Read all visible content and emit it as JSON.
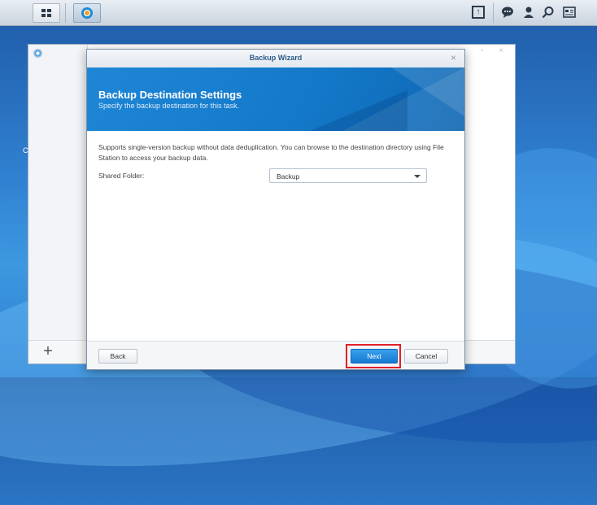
{
  "taskbar": {
    "main_menu_icon": "grid-icon",
    "active_app_icon": "backup-app-icon",
    "tray_icons": [
      "upload-icon",
      "chat-icon",
      "user-icon",
      "search-icon",
      "widgets-icon"
    ]
  },
  "background_window": {
    "add_label": "+",
    "edge_text": "C"
  },
  "wizard": {
    "window_title": "Backup Wizard",
    "close_label": "×",
    "header_title": "Backup Destination Settings",
    "header_subtitle": "Specify the backup destination for this task.",
    "description": "Supports single-version backup without data deduplication. You can browse to the destination directory using File Station to access your backup data.",
    "shared_folder_label": "Shared Folder:",
    "shared_folder_value": "Backup",
    "back_label": "Back",
    "next_label": "Next",
    "cancel_label": "Cancel"
  },
  "colors": {
    "accent": "#1479d3",
    "highlight": "#e0202a"
  }
}
